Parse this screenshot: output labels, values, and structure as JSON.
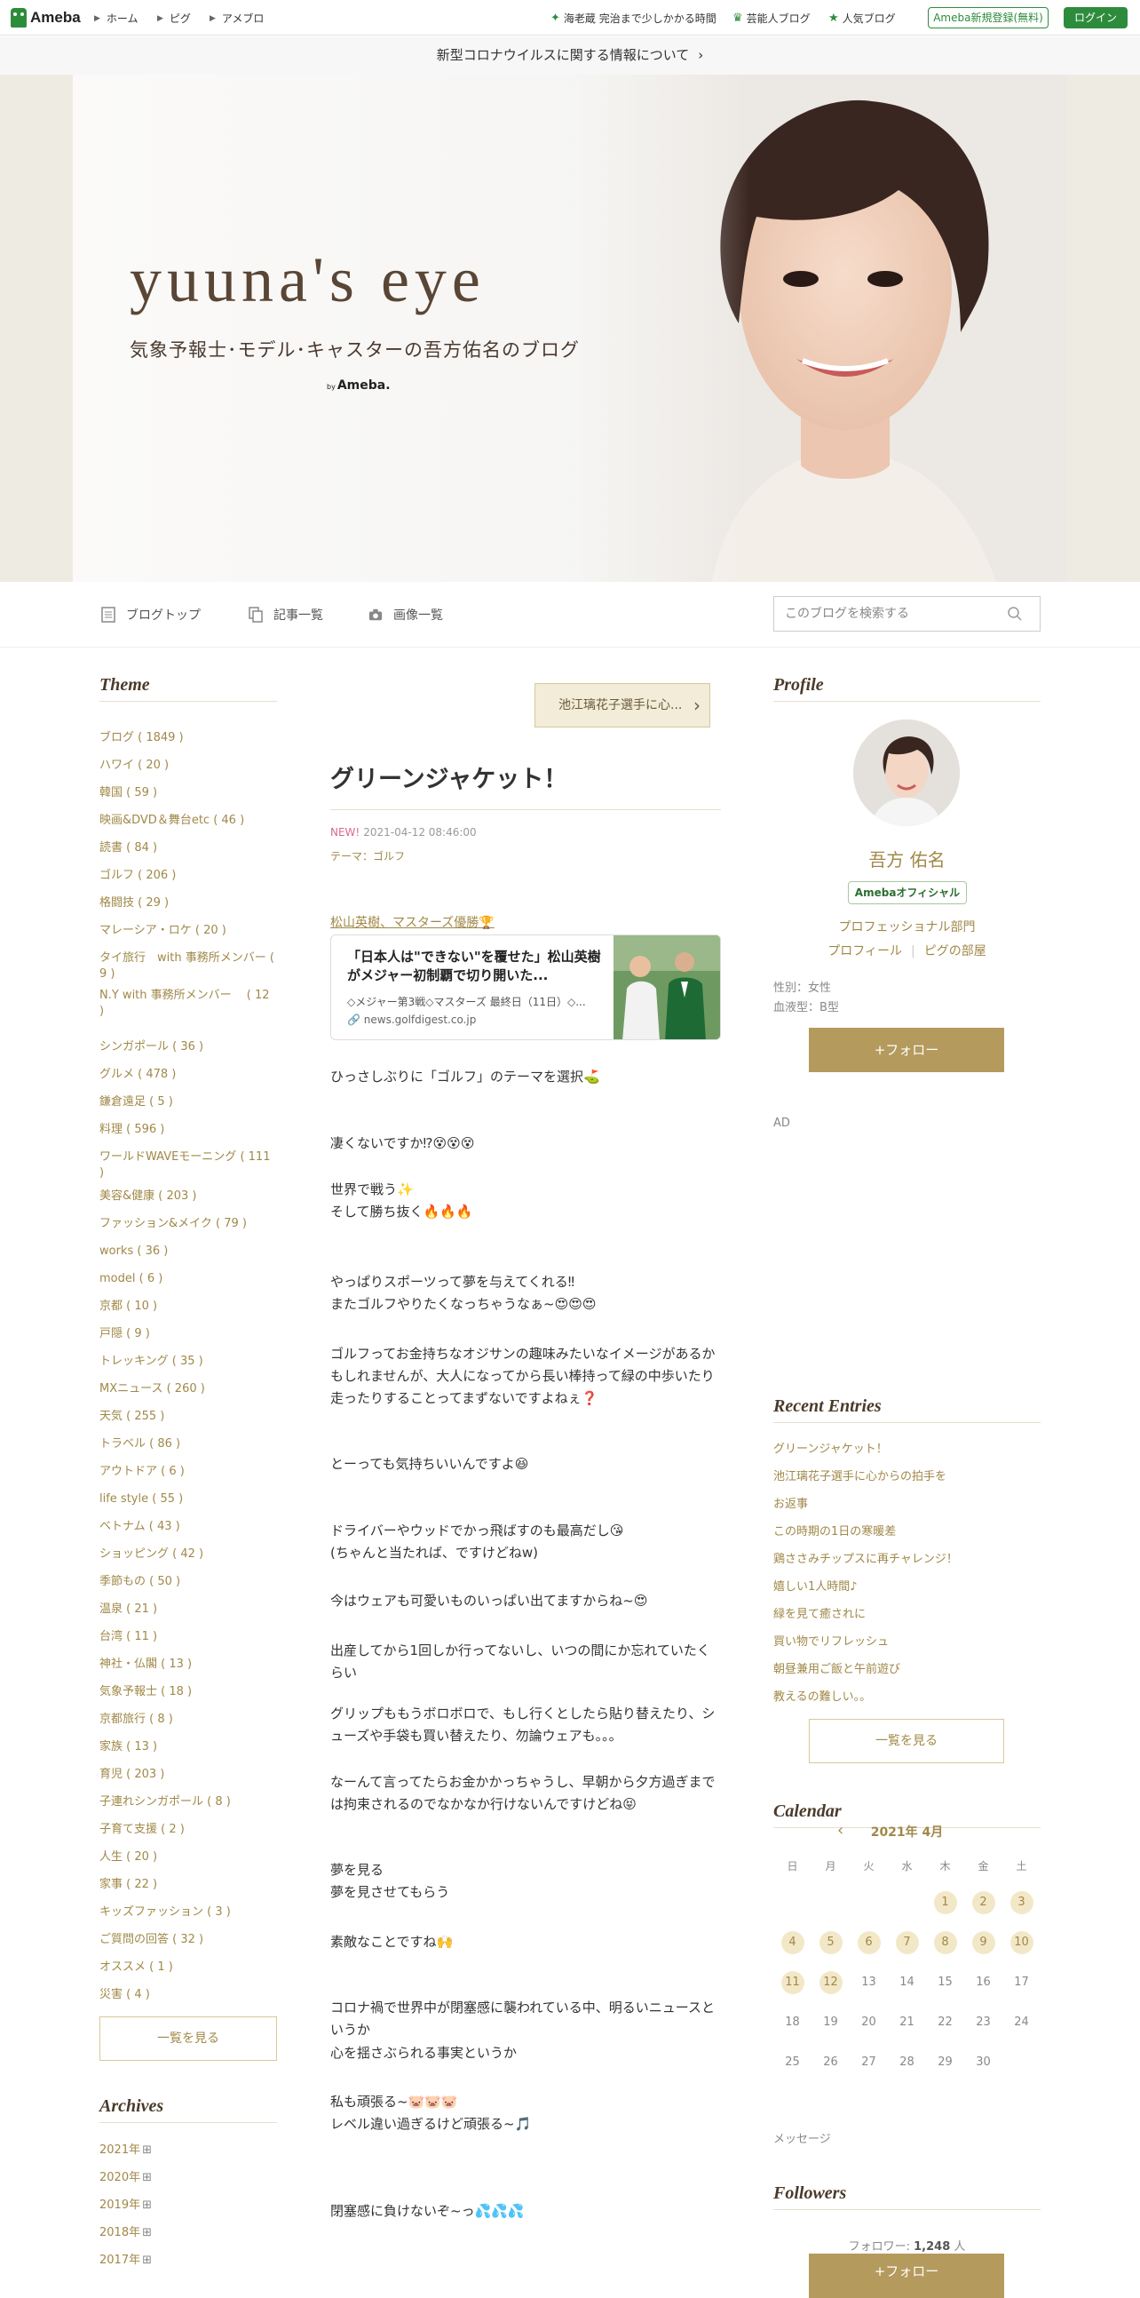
{
  "topbar": {
    "logo_text": "Ameba",
    "nav": [
      "ホーム",
      "ピグ",
      "アメブロ"
    ],
    "right_links": [
      "海老蔵 完治まで少しかかる時間",
      "芸能人ブログ",
      "人気ブログ"
    ],
    "register_label": "Ameba新規登録(無料)",
    "login_label": "ログイン"
  },
  "notice": {
    "text": "新型コロナウイルスに関する情報について"
  },
  "banner": {
    "title": "yuuna's eye",
    "subtitle": "気象予報士･モデル･キャスターの吾方佑名のブログ",
    "by": "by",
    "brand": "Ameba."
  },
  "blog_nav": {
    "items": [
      "ブログトップ",
      "記事一覧",
      "画像一覧"
    ],
    "search_placeholder": "このブログを検索する"
  },
  "left": {
    "theme_heading": "Theme",
    "themes": [
      "ブログ ( 1849 )",
      "ハワイ ( 20 )",
      "韓国 ( 59 )",
      "映画&DVD＆舞台etc ( 46 )",
      "読書 ( 84 )",
      "ゴルフ ( 206 )",
      "格闘技 ( 29 )",
      "マレーシア・ロケ ( 20 )",
      "タイ旅行　with 事務所メンバー ( 9 )",
      "N.Y with 事務所メンバー　 ( 12 )",
      "シンガポール ( 36 )",
      "グルメ ( 478 )",
      "鎌倉遠足 ( 5 )",
      "料理 ( 596 )",
      "ワールドWAVEモーニング ( 111 )",
      "美容&健康 ( 203 )",
      "ファッション&メイク ( 79 )",
      "works ( 36 )",
      "model ( 6 )",
      "京都 ( 10 )",
      "戸隠 ( 9 )",
      "トレッキング ( 35 )",
      "MXニュース ( 260 )",
      "天気 ( 255 )",
      "トラベル ( 86 )",
      "アウトドア ( 6 )",
      "life style ( 55 )",
      "ベトナム ( 43 )",
      "ショッピング ( 42 )",
      "季節もの ( 50 )",
      "温泉 ( 21 )",
      "台湾 ( 11 )",
      "神社・仏閣 ( 13 )",
      "気象予報士 ( 18 )",
      "京都旅行 ( 8 )",
      "家族 ( 13 )",
      "育児 ( 203 )",
      "子連れシンガポール ( 8 )",
      "子育て支援 ( 2 )",
      "人生 ( 20 )",
      "家事 ( 22 )",
      "キッズファッション ( 3 )",
      "ご質問の回答 ( 32 )",
      "オススメ ( 1 )",
      "災害 ( 4 )"
    ],
    "see_all": "一覧を見る",
    "archives_heading": "Archives",
    "archives": [
      "2021年",
      "2020年",
      "2019年",
      "2018年",
      "2017年"
    ]
  },
  "main": {
    "prev_entry": "池江璃花子選手に心...",
    "title": "グリーンジャケット！",
    "new_label": "NEW!",
    "date": "2021-04-12 08:46:00",
    "theme": "テーマ：ゴルフ",
    "link_text": "松山英樹、マスターズ優勝🏆",
    "card": {
      "title": "「日本人は\"できない\"を覆せた」松山英樹がメジャー初制覇で切り開いた...",
      "desc": "◇メジャー第3戦◇マスターズ 最終日（11日）◇...",
      "url": "news.golfdigest.co.jp"
    },
    "paragraphs": [
      "ひっさしぶりに「ゴルフ」のテーマを選択⛳",
      "凄くないですか⁉😵😵😵",
      "世界で戦う✨\nそして勝ち抜く🔥🔥🔥",
      "やっぱりスポーツって夢を与えてくれる‼\nまたゴルフやりたくなっちゃうなぁ~😍😍😍",
      "ゴルフってお金持ちなオジサンの趣味みたいなイメージがあるかもしれませんが、大人になってから長い棒持って緑の中歩いたり走ったりすることってまずないですよねぇ❓",
      "とーっても気持ちいいんですよ😆",
      "ドライバーやウッドでかっ飛ばすのも最高だし😘\n(ちゃんと当たれば、ですけどねw)",
      "今はウェアも可愛いものいっぱい出てますからね~😍",
      "出産してから1回しか行ってないし、いつの間にか忘れていたくらい",
      "グリップももうボロボロで、もし行くとしたら貼り替えたり、シューズや手袋も買い替えたり、勿論ウェアも。。。",
      "なーんて言ってたらお金かかっちゃうし、早朝から夕方過ぎまでは拘束されるのでなかなか行けないんですけどね😝",
      "夢を見る\n夢を見させてもらう",
      "素敵なことですね🙌",
      "コロナ禍で世界中が閉塞感に襲われている中、明るいニュースというか",
      "心を揺さぶられる事実というか",
      "私も頑張る~🐷🐷🐷\nレベル違い過ぎるけど頑張る~🎵",
      "閉塞感に負けないぞ~っ💦💦💦"
    ]
  },
  "right": {
    "profile_heading": "Profile",
    "name": "吾方 佑名",
    "official": "Amebaオフィシャル",
    "category": "プロフェッショナル部門",
    "profile_link": "プロフィール",
    "pigg_link": "ピグの部屋",
    "gender": "性別：女性",
    "blood": "血液型：B型",
    "follow": "+フォロー",
    "ad": "AD",
    "recent_heading": "Recent Entries",
    "recent": [
      "グリーンジャケット！",
      "池江璃花子選手に心からの拍手を",
      "お返事",
      "この時期の1日の寒暖差",
      "鶏ささみチップスに再チャレンジ！",
      "嬉しい1人時間♪",
      "緑を見て癒されに",
      "買い物でリフレッシュ",
      "朝昼兼用ご飯と午前遊び",
      "教えるの難しい。。"
    ],
    "recent_more": "一覧を見る",
    "calendar_heading": "Calendar",
    "calendar_month": "2021年 4月",
    "dow": [
      "日",
      "月",
      "火",
      "水",
      "木",
      "金",
      "土"
    ],
    "calendar_rows": [
      [
        "",
        "",
        "",
        "",
        "1",
        "2",
        "3"
      ],
      [
        "4",
        "5",
        "6",
        "7",
        "8",
        "9",
        "10"
      ],
      [
        "11",
        "12",
        "13",
        "14",
        "15",
        "16",
        "17"
      ],
      [
        "18",
        "19",
        "20",
        "21",
        "22",
        "23",
        "24"
      ],
      [
        "25",
        "26",
        "27",
        "28",
        "29",
        "30",
        ""
      ]
    ],
    "posted_days": [
      1,
      2,
      3,
      4,
      5,
      6,
      7,
      8,
      9,
      10,
      11,
      12
    ],
    "message": "メッセージ",
    "followers_heading": "Followers",
    "follower_label": "フォロワー:",
    "follower_count": "1,248",
    "follower_unit": "人",
    "follow2": "+フォロー"
  }
}
